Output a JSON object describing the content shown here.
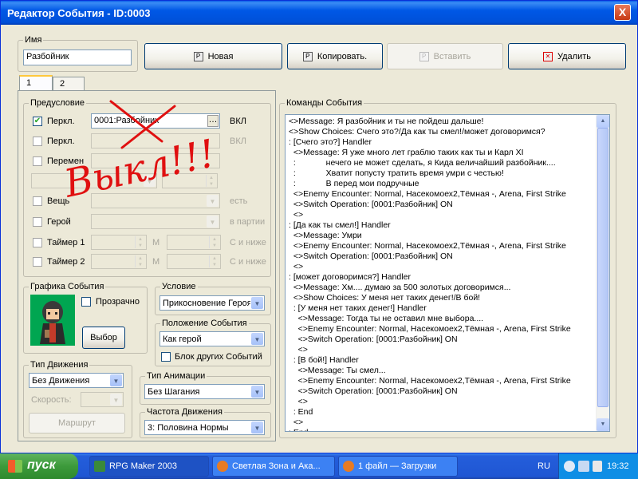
{
  "window": {
    "title": "Редактор События - ID:0003",
    "close": "X"
  },
  "name_group": {
    "label": "Имя",
    "value": "Разбойник"
  },
  "toolbar": {
    "new": "Новая",
    "copy": "Копировать.",
    "paste": "Вставить",
    "delete": "Удалить"
  },
  "tabs": [
    "1",
    "2"
  ],
  "condition": {
    "legend": "Предусловие",
    "switch1": {
      "label": "Перкл.",
      "value": "0001:Разбойник",
      "state": "ВКЛ",
      "checked": "✔"
    },
    "switch2": {
      "label": "Перкл.",
      "state": "ВКЛ"
    },
    "variable": {
      "label": "Перемен"
    },
    "item": {
      "label": "Вещь",
      "suffix": "есть"
    },
    "hero": {
      "label": "Герой",
      "suffix": "в партии"
    },
    "timer1": {
      "label": "Таймер 1",
      "unit_m": "М",
      "suffix": "С и ниже"
    },
    "timer2": {
      "label": "Таймер 2",
      "unit_m": "М",
      "suffix": "С и ниже"
    }
  },
  "handwriting": {
    "text": "Выкл!!!",
    "color": "#e01010"
  },
  "graphic": {
    "legend": "Графика События",
    "transparent": "Прозрачно",
    "select": "Выбор"
  },
  "trigger": {
    "legend": "Условие",
    "value": "Прикосновение Героя"
  },
  "position": {
    "legend": "Положение События",
    "value": "Как герой",
    "block": "Блок других Событий"
  },
  "movement": {
    "legend": "Тип Движения",
    "value": "Без Движения",
    "speed_label": "Скорость:",
    "route": "Маршрут"
  },
  "animation": {
    "legend": "Тип Анимации",
    "value": "Без Шагания"
  },
  "frequency": {
    "legend": "Частота Движения",
    "value": "3: Половина Нормы"
  },
  "commands": {
    "legend": "Команды События",
    "lines": [
      "<>Message: Я разбойник и ты не пойдеш дальше!",
      "<>Show Choices: Счего это?/Да как ты смел!/может договоримся?",
      ": [Счего это?] Handler",
      "  <>Message: Я уже много лет граблю таких как ты и Карл XI",
      "  :             нечего не может сделать, я Кида величайший разбойник....",
      "  :             Хватит попусту тратить время умри с честью!",
      "  :             В перед мои подручные",
      "  <>Enemy Encounter: Normal, Насекомоех2,Тёмная -, Arena, First Strike",
      "  <>Switch Operation: [0001:Разбойник] ON",
      "  <>",
      ": [Да как ты смел!] Handler",
      "  <>Message: Умри",
      "  <>Enemy Encounter: Normal, Насекомоех2,Тёмная -, Arena, First Strike",
      "  <>Switch Operation: [0001:Разбойник] ON",
      "  <>",
      ": [может договоримся?] Handler",
      "  <>Message: Хм.... думаю за 500 золотых договоримся...",
      "  <>Show Choices: У меня нет таких денег!/В бой!",
      "  : [У меня нет таких денег!] Handler",
      "    <>Message: Тогда ты не оставил мне выбора....",
      "    <>Enemy Encounter: Normal, Насекомоех2,Тёмная -, Arena, First Strike",
      "    <>Switch Operation: [0001:Разбойник] ON",
      "    <>",
      "  : [В бой!] Handler",
      "    <>Message: Ты смел...",
      "    <>Enemy Encounter: Normal, Насекомоех2,Тёмная -, Arena, First Strike",
      "    <>Switch Operation: [0001:Разбойник] ON",
      "    <>",
      "  : End",
      "  <>",
      ": End"
    ]
  },
  "taskbar": {
    "start": "пуск",
    "tasks": [
      "RPG Maker 2003",
      "Светлая Зона и Ака...",
      "1 файл — Загрузки"
    ],
    "lang": "RU",
    "clock": "19:32"
  }
}
